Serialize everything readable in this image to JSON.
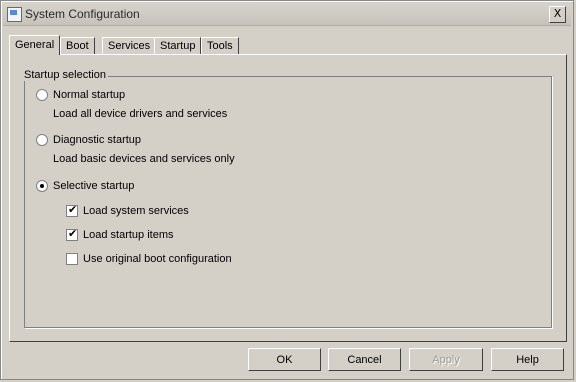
{
  "window": {
    "title": "System Configuration",
    "close_label": "X"
  },
  "tabs": [
    {
      "label": "General",
      "active": true
    },
    {
      "label": "Boot",
      "active": false
    },
    {
      "label": "Services",
      "active": false
    },
    {
      "label": "Startup",
      "active": false
    },
    {
      "label": "Tools",
      "active": false
    }
  ],
  "startup_selection": {
    "group_label": "Startup selection",
    "normal": {
      "label": "Normal startup",
      "description": "Load all device drivers and services",
      "selected": false
    },
    "diagnostic": {
      "label": "Diagnostic startup",
      "description": "Load basic devices and services only",
      "selected": false
    },
    "selective": {
      "label": "Selective startup",
      "selected": true
    },
    "options": [
      {
        "label": "Load system services",
        "checked": true
      },
      {
        "label": "Load startup items",
        "checked": true
      },
      {
        "label": "Use original boot configuration",
        "checked": false
      }
    ]
  },
  "buttons": {
    "ok": "OK",
    "cancel": "Cancel",
    "apply": "Apply",
    "help": "Help"
  }
}
